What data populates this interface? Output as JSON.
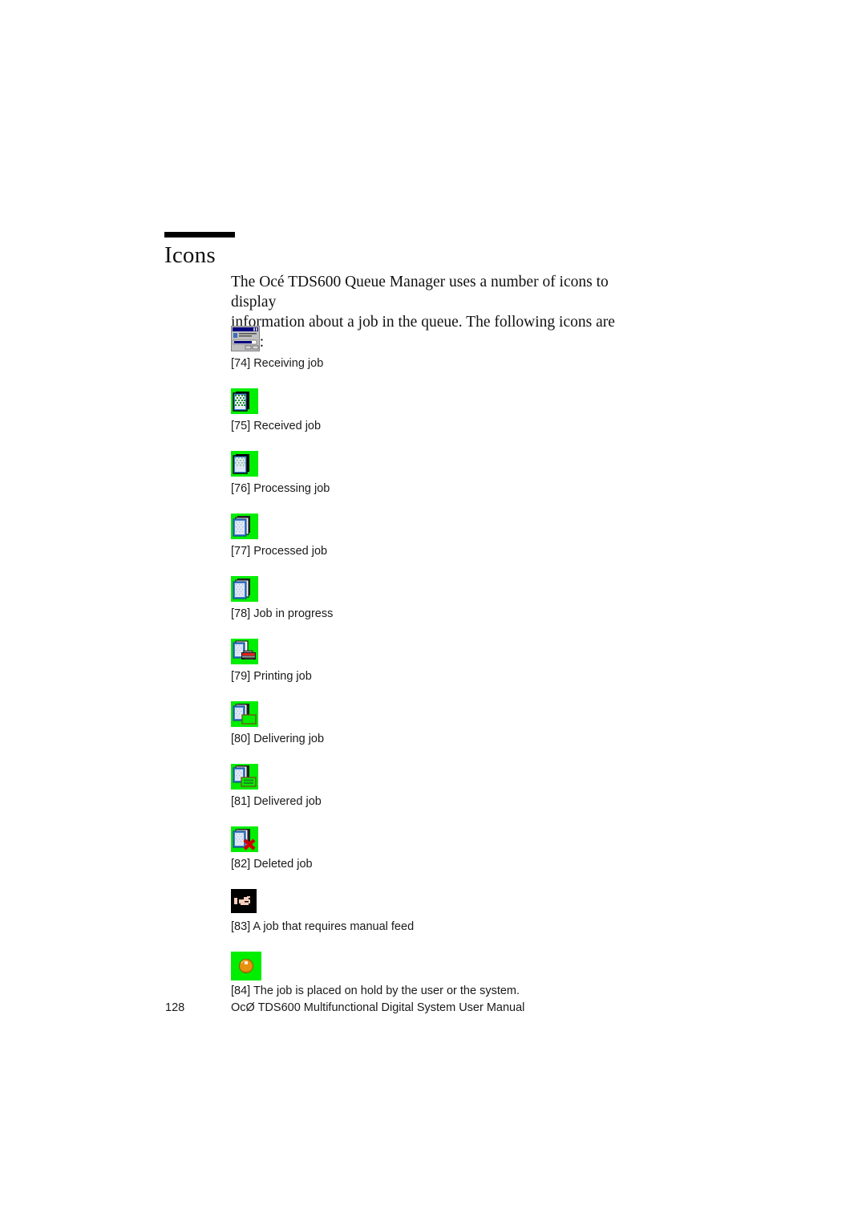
{
  "document": {
    "heading": "Icons",
    "intro_line_1": "The Océ TDS600 Queue Manager uses a number of icons to display",
    "intro_line_2": "information about a job in the queue. The following icons are used:"
  },
  "icons": [
    {
      "number": "[74]",
      "caption": "[74] Receiving job",
      "label": "Receiving job",
      "icon_name": "receiving-job-dialog-icon",
      "background": "#c0c0c0"
    },
    {
      "number": "[75]",
      "caption": "[75] Received job",
      "label": "Received job",
      "icon_name": "received-job-document-icon",
      "background": "#00ee00"
    },
    {
      "number": "[76]",
      "caption": "[76] Processing job",
      "label": "Processing job",
      "icon_name": "processing-job-document-icon",
      "background": "#00ee00"
    },
    {
      "number": "[77]",
      "caption": "[77] Processed job",
      "label": "Processed job",
      "icon_name": "processed-job-stack-icon",
      "background": "#00ee00"
    },
    {
      "number": "[78]",
      "caption": "[78] Job in progress",
      "label": "Job in progress",
      "icon_name": "job-in-progress-stack-icon",
      "background": "#00ee00"
    },
    {
      "number": "[79]",
      "caption": "[79] Printing job",
      "label": "Printing job",
      "icon_name": "printing-job-printer-icon",
      "background": "#00ee00"
    },
    {
      "number": "[80]",
      "caption": "[80] Delivering job",
      "label": "Delivering job",
      "icon_name": "delivering-job-tray-icon",
      "background": "#00ee00"
    },
    {
      "number": "[81]",
      "caption": "[81] Delivered job",
      "label": "Delivered job",
      "icon_name": "delivered-job-output-icon",
      "background": "#00ee00"
    },
    {
      "number": "[82]",
      "caption": "[82] Deleted job",
      "label": "Deleted job",
      "icon_name": "deleted-job-red-x-icon",
      "background": "#00ee00"
    },
    {
      "number": "[83]",
      "caption": "[83] A job that requires manual feed",
      "label": "A job that requires manual feed",
      "icon_name": "manual-feed-hand-icon",
      "background": "#000000"
    },
    {
      "number": "[84]",
      "caption": "[84] The job is placed on hold by the user or the system.",
      "label": "The job is placed on hold by the user or the system.",
      "icon_name": "job-on-hold-orange-ball-icon",
      "background": "#00ee00"
    }
  ],
  "footer": {
    "page_number": "128",
    "text": "OcØ TDS600 Multifunctional Digital System User Manual"
  },
  "colors": {
    "icon_green": "#00ee00",
    "paper_blue": "#3d7fd6",
    "paper_fill": "#ccd4e8",
    "dark_outline": "#000000",
    "red_accent": "#e00000",
    "orange_ball": "#e88a10",
    "dialog_grey": "#c0c0c0",
    "title_blue": "#000080",
    "hand_skin": "#f4cdbd"
  }
}
